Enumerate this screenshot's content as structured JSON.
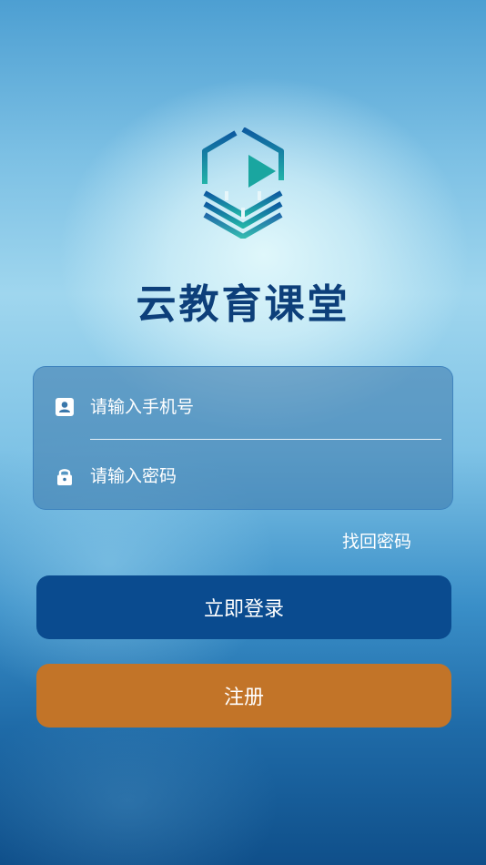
{
  "app": {
    "title": "云教育课堂"
  },
  "login_form": {
    "phone_placeholder": "请输入手机号",
    "password_placeholder": "请输入密码",
    "phone_icon": "contact-card-icon",
    "password_icon": "lock-icon"
  },
  "links": {
    "forgot_password": "找回密码"
  },
  "buttons": {
    "login_label": "立即登录",
    "register_label": "注册"
  },
  "colors": {
    "title": "#0d3f7a",
    "login_button": "#0a4b8f",
    "register_button": "#c27428",
    "logo_top": "#0d5aa0",
    "logo_bottom": "#22b3a8"
  }
}
